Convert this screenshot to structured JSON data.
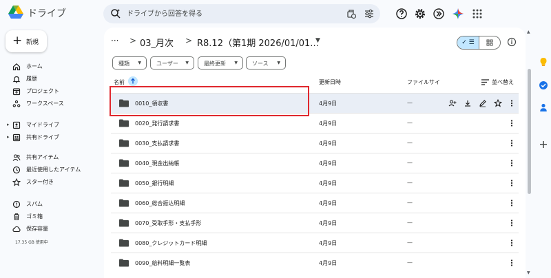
{
  "app": {
    "name": "ドライブ"
  },
  "search": {
    "placeholder": "ドライブから回答を得る"
  },
  "new_button": {
    "label": "新規"
  },
  "nav": {
    "items": [
      {
        "label": "ホーム",
        "icon": "home-icon"
      },
      {
        "label": "履歴",
        "icon": "bell-icon"
      },
      {
        "label": "プロジェクト",
        "icon": "project-icon"
      },
      {
        "label": "ワークスペース",
        "icon": "workspace-icon"
      },
      {
        "label": "マイドライブ",
        "icon": "my-drive-icon"
      },
      {
        "label": "共有ドライブ",
        "icon": "shared-drive-icon"
      },
      {
        "label": "共有アイテム",
        "icon": "people-icon"
      },
      {
        "label": "最近使用したアイテム",
        "icon": "clock-icon"
      },
      {
        "label": "スター付き",
        "icon": "star-icon"
      },
      {
        "label": "スパム",
        "icon": "spam-icon"
      },
      {
        "label": "ゴミ箱",
        "icon": "trash-icon"
      },
      {
        "label": "保存容量",
        "icon": "cloud-icon"
      }
    ],
    "storage_text": "17.35 GB 使用中"
  },
  "breadcrumb": {
    "more": "···",
    "separator": ">",
    "items": [
      "03_月次",
      "R8.12（第1期 2026/01/01..."
    ]
  },
  "filters": [
    "種類",
    "ユーザー",
    "最終更新",
    "ソース"
  ],
  "table": {
    "headers": {
      "name": "名前",
      "modified": "更新日時",
      "size": "ファイルサイ",
      "sort": "並べ替え"
    },
    "rows": [
      {
        "name": "0010_領収書",
        "date": "4月9日",
        "size": "—"
      },
      {
        "name": "0020_発行請求書",
        "date": "4月9日",
        "size": "—"
      },
      {
        "name": "0030_支払請求書",
        "date": "4月9日",
        "size": "—"
      },
      {
        "name": "0040_現金出納帳",
        "date": "4月9日",
        "size": "—"
      },
      {
        "name": "0050_銀行明細",
        "date": "4月9日",
        "size": "—"
      },
      {
        "name": "0060_総合振込明細",
        "date": "4月9日",
        "size": "—"
      },
      {
        "name": "0070_受取手形・支払手形",
        "date": "4月9日",
        "size": "—"
      },
      {
        "name": "0080_クレジットカード明細",
        "date": "4月9日",
        "size": "—"
      },
      {
        "name": "0090_給料明細一覧表",
        "date": "4月9日",
        "size": "—"
      }
    ]
  },
  "colors": {
    "accent": "#0b57d0",
    "selected_row": "#e9eef6",
    "highlight": "#e0282e",
    "chip_selected": "#c2e7ff"
  }
}
